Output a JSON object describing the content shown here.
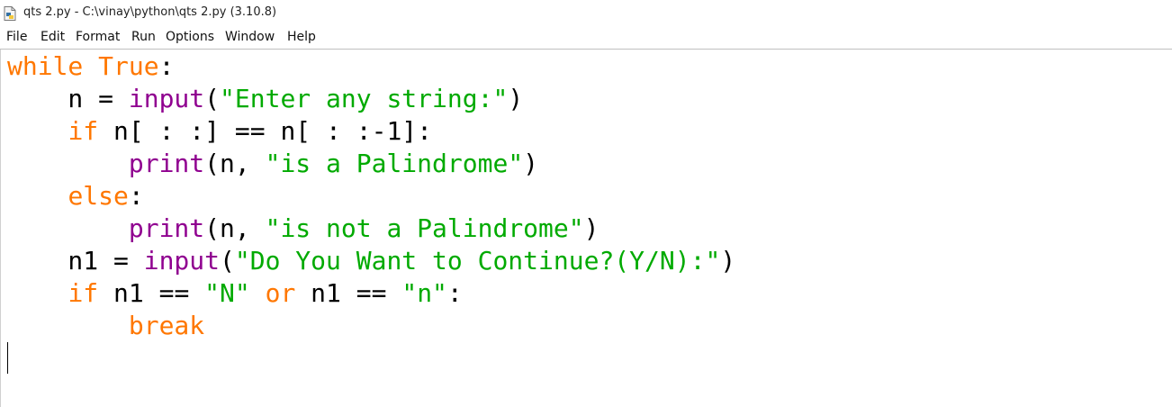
{
  "window": {
    "title": "qts 2.py - C:\\vinay\\python\\qts 2.py (3.10.8)",
    "icon": "python-file-icon"
  },
  "menu": {
    "items": [
      {
        "label": "File"
      },
      {
        "label": "Edit"
      },
      {
        "label": "Format"
      },
      {
        "label": "Run"
      },
      {
        "label": "Options"
      },
      {
        "label": "Window"
      },
      {
        "label": "Help"
      }
    ]
  },
  "colors": {
    "keyword": "#ff7700",
    "builtin": "#900090",
    "string": "#00aa00",
    "default": "#000000"
  },
  "code": {
    "lines": [
      [
        {
          "t": "while",
          "c": "kw"
        },
        {
          "t": " "
        },
        {
          "t": "True",
          "c": "kw"
        },
        {
          "t": ":"
        }
      ],
      [
        {
          "t": "    n = "
        },
        {
          "t": "input",
          "c": "bi"
        },
        {
          "t": "("
        },
        {
          "t": "\"Enter any string:\"",
          "c": "str"
        },
        {
          "t": ")"
        }
      ],
      [
        {
          "t": "    "
        },
        {
          "t": "if",
          "c": "kw"
        },
        {
          "t": " n[ : :] == n[ : :-1]:"
        }
      ],
      [
        {
          "t": "        "
        },
        {
          "t": "print",
          "c": "bi"
        },
        {
          "t": "(n, "
        },
        {
          "t": "\"is a Palindrome\"",
          "c": "str"
        },
        {
          "t": ")"
        }
      ],
      [
        {
          "t": "    "
        },
        {
          "t": "else",
          "c": "kw"
        },
        {
          "t": ":"
        }
      ],
      [
        {
          "t": "        "
        },
        {
          "t": "print",
          "c": "bi"
        },
        {
          "t": "(n, "
        },
        {
          "t": "\"is not a Palindrome\"",
          "c": "str"
        },
        {
          "t": ")"
        }
      ],
      [
        {
          "t": "    n1 = "
        },
        {
          "t": "input",
          "c": "bi"
        },
        {
          "t": "("
        },
        {
          "t": "\"Do You Want to Continue?(Y/N):\"",
          "c": "str"
        },
        {
          "t": ")"
        }
      ],
      [
        {
          "t": "    "
        },
        {
          "t": "if",
          "c": "kw"
        },
        {
          "t": " n1 == "
        },
        {
          "t": "\"N\"",
          "c": "str"
        },
        {
          "t": " "
        },
        {
          "t": "or",
          "c": "kw"
        },
        {
          "t": " n1 == "
        },
        {
          "t": "\"n\"",
          "c": "str"
        },
        {
          "t": ":"
        }
      ],
      [
        {
          "t": "        "
        },
        {
          "t": "break",
          "c": "kw"
        }
      ],
      [
        {
          "t": ""
        }
      ]
    ]
  }
}
